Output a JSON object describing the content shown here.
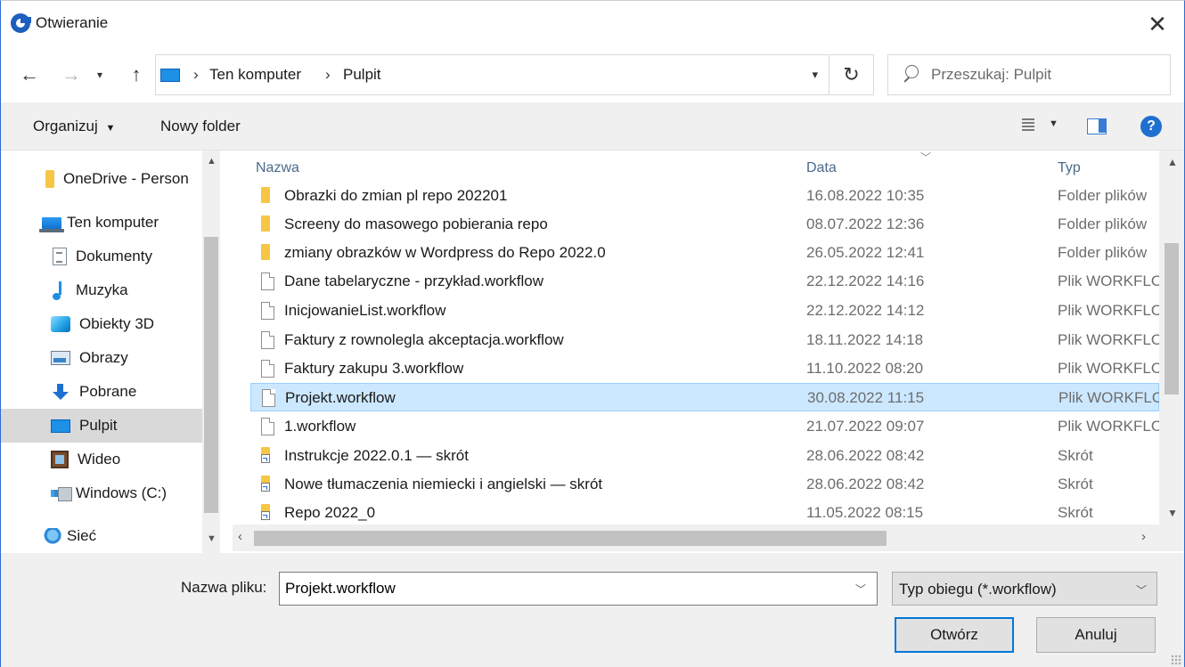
{
  "window": {
    "title": "Otwieranie"
  },
  "nav": {
    "breadcrumbs": [
      "Ten komputer",
      "Pulpit"
    ],
    "search_placeholder": "Przeszukaj: Pulpit"
  },
  "toolbar": {
    "organize_label": "Organizuj",
    "new_folder_label": "Nowy folder"
  },
  "sidebar": {
    "items": [
      {
        "label": "OneDrive - Person",
        "icon": "folder-icon"
      },
      {
        "label": "Ten komputer",
        "icon": "computer-icon"
      },
      {
        "label": "Dokumenty",
        "icon": "documents-icon"
      },
      {
        "label": "Muzyka",
        "icon": "music-icon"
      },
      {
        "label": "Obiekty 3D",
        "icon": "3d-objects-icon"
      },
      {
        "label": "Obrazy",
        "icon": "pictures-icon"
      },
      {
        "label": "Pobrane",
        "icon": "downloads-icon"
      },
      {
        "label": "Pulpit",
        "icon": "desktop-icon",
        "selected": true
      },
      {
        "label": "Wideo",
        "icon": "video-icon"
      },
      {
        "label": "Windows (C:)",
        "icon": "drive-icon"
      },
      {
        "label": "Sieć",
        "icon": "network-icon"
      }
    ]
  },
  "filelist": {
    "columns": [
      "Nazwa",
      "Data",
      "Typ"
    ],
    "rows": [
      {
        "name": "Obrazki do zmian pl repo 202201",
        "date": "16.08.2022 10:35",
        "type": "Folder plików",
        "icon": "folder-icon"
      },
      {
        "name": "Screeny do masowego pobierania repo",
        "date": "08.07.2022 12:36",
        "type": "Folder plików",
        "icon": "folder-icon"
      },
      {
        "name": "zmiany obrazków w Wordpress do Repo 2022.0",
        "date": "26.05.2022 12:41",
        "type": "Folder plików",
        "icon": "folder-icon"
      },
      {
        "name": "Dane tabelaryczne - przykład.workflow",
        "date": "22.12.2022 14:16",
        "type": "Plik WORKFLOW",
        "icon": "file-icon"
      },
      {
        "name": "InicjowanieList.workflow",
        "date": "22.12.2022 14:12",
        "type": "Plik WORKFLOW",
        "icon": "file-icon"
      },
      {
        "name": "Faktury z rownolegla akceptacja.workflow",
        "date": "18.11.2022 14:18",
        "type": "Plik WORKFLOW",
        "icon": "file-icon"
      },
      {
        "name": "Faktury zakupu 3.workflow",
        "date": "11.10.2022 08:20",
        "type": "Plik WORKFLOW",
        "icon": "file-icon"
      },
      {
        "name": "Projekt.workflow",
        "date": "30.08.2022 11:15",
        "type": "Plik WORKFLOW",
        "icon": "file-icon",
        "selected": true
      },
      {
        "name": "1.workflow",
        "date": "21.07.2022 09:07",
        "type": "Plik WORKFLOW",
        "icon": "file-icon"
      },
      {
        "name": "Instrukcje 2022.0.1 — skrót",
        "date": "28.06.2022 08:42",
        "type": "Skrót",
        "icon": "shortcut-icon"
      },
      {
        "name": "Nowe tłumaczenia niemiecki i angielski — skrót",
        "date": "28.06.2022 08:42",
        "type": "Skrót",
        "icon": "shortcut-icon"
      },
      {
        "name": "Repo 2022_0",
        "date": "11.05.2022 08:15",
        "type": "Skrót",
        "icon": "shortcut-icon"
      }
    ]
  },
  "footer": {
    "filename_label": "Nazwa pliku:",
    "filename_value": "Projekt.workflow",
    "filetype_value": "Typ obiegu (*.workflow)",
    "open_label": "Otwórz",
    "cancel_label": "Anuluj"
  },
  "colors": {
    "accent": "#0078d7",
    "selection": "#cce8ff",
    "folder": "#f6c644"
  }
}
